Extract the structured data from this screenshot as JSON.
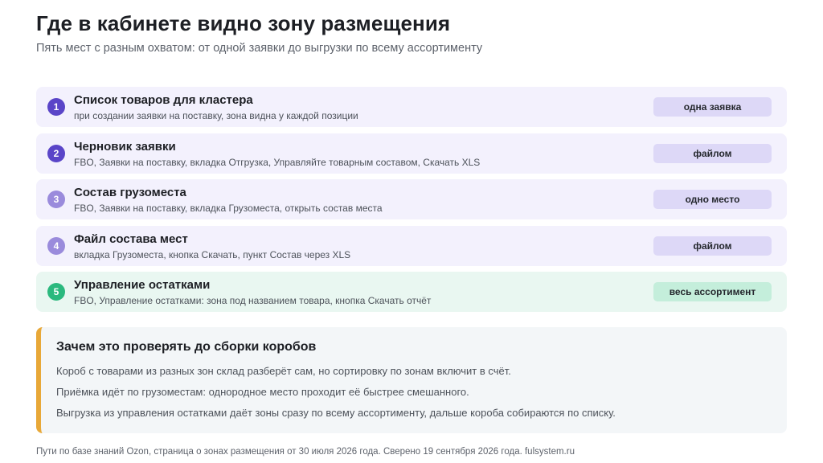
{
  "header": {
    "title": "Где в кабинете видно зону размещения",
    "subtitle": "Пять мест с разным охватом: от одной заявки до выгрузки по всему ассортименту"
  },
  "rows": [
    {
      "num": "1",
      "title": "Список товаров для кластера",
      "desc": "при создании заявки на поставку, зона видна у каждой позиции",
      "badge": "одна заявка"
    },
    {
      "num": "2",
      "title": "Черновик заявки",
      "desc": "FBO, Заявки на поставку, вкладка Отгрузка, Управляйте товарным составом, Скачать XLS",
      "badge": "файлом"
    },
    {
      "num": "3",
      "title": "Состав грузоместа",
      "desc": "FBO, Заявки на поставку, вкладка Грузоместа, открыть состав места",
      "badge": "одно место"
    },
    {
      "num": "4",
      "title": "Файл состава мест",
      "desc": "вкладка Грузоместа, кнопка Скачать, пункт Состав через XLS",
      "badge": "файлом"
    },
    {
      "num": "5",
      "title": "Управление остатками",
      "desc": "FBO, Управление остатками: зона под названием товара, кнопка Скачать отчёт",
      "badge": "весь ассортимент"
    }
  ],
  "note": {
    "title": "Зачем это проверять до сборки коробов",
    "lines": [
      "Короб с товарами из разных зон склад разберёт сам, но сортировку по зонам включит в счёт.",
      "Приёмка идёт по грузоместам: однородное место проходит её быстрее смешанного.",
      "Выгрузка из управления остатками даёт зоны сразу по всему ассортименту, дальше короба собираются по списку."
    ]
  },
  "footer": "Пути по базе знаний Ozon, страница о зонах размещения от 30 июля 2026 года. Сверено 19 сентября 2026 года. fulsystem.ru",
  "colors": {
    "accent_purple": "#5a45c8",
    "accent_purple_light": "#9a8bdc",
    "accent_green": "#2bb97e",
    "note_bar": "#e8a838"
  }
}
